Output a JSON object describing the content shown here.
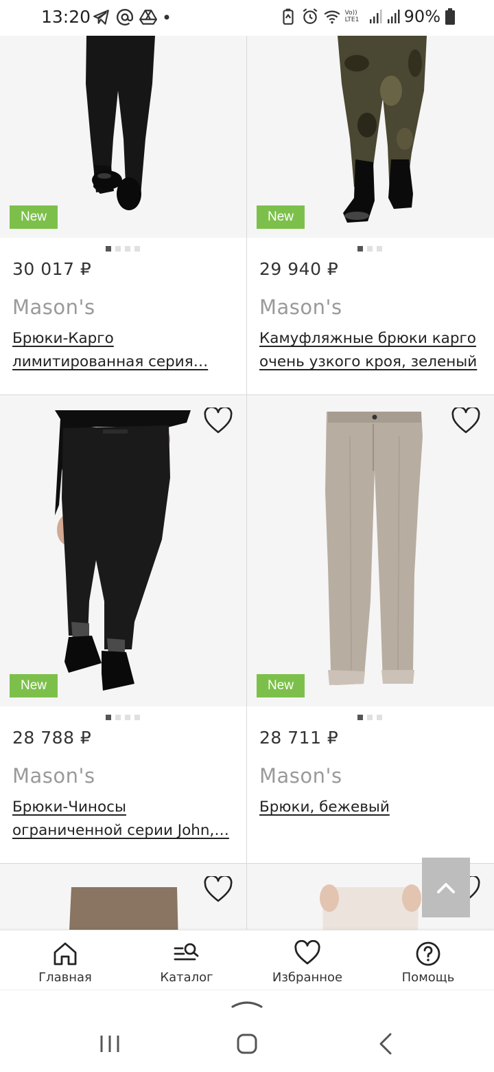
{
  "status_bar": {
    "time": "13:20",
    "battery": "90%",
    "left_icons": [
      "telegram-icon",
      "at-sign-icon",
      "drive-icon",
      "dot-icon"
    ],
    "right_icons": [
      "battery-saver-icon",
      "alarm-icon",
      "wifi-icon",
      "volte-icon",
      "signal-icon",
      "signal-icon",
      "battery-icon"
    ],
    "volte_label": "Vo)) LTE1"
  },
  "products": [
    {
      "price": "30 017 ₽",
      "brand": "Mason's",
      "title_lines": [
        "Брюки-Карго",
        "лимитированная серия…"
      ],
      "badge": "New",
      "image_dots": 4,
      "active_dot": 0
    },
    {
      "price": "29 940 ₽",
      "brand": "Mason's",
      "title_lines": [
        "Камуфляжные брюки карго",
        "очень узкого кроя, зеленый"
      ],
      "badge": "New",
      "image_dots": 3,
      "active_dot": 0
    },
    {
      "price": "28 788 ₽",
      "brand": "Mason's",
      "title_lines": [
        "Брюки-Чиносы",
        "ограниченной серии John,…"
      ],
      "badge": "New",
      "image_dots": 4,
      "active_dot": 0
    },
    {
      "price": "28 711 ₽",
      "brand": "Mason's",
      "title_lines": [
        "Брюки, бежевый"
      ],
      "badge": "New",
      "image_dots": 3,
      "active_dot": 0
    }
  ],
  "bottom_nav": [
    {
      "label": "Главная",
      "icon": "home-icon"
    },
    {
      "label": "Каталог",
      "icon": "catalog-search-icon"
    },
    {
      "label": "Избранное",
      "icon": "heart-icon"
    },
    {
      "label": "Помощь",
      "icon": "help-icon"
    }
  ],
  "colors": {
    "badge_green": "#7cc04b",
    "brand_gray": "#9a9a9a",
    "image_bg": "#f5f5f5",
    "scroll_top_bg": "#bdbdbd"
  }
}
